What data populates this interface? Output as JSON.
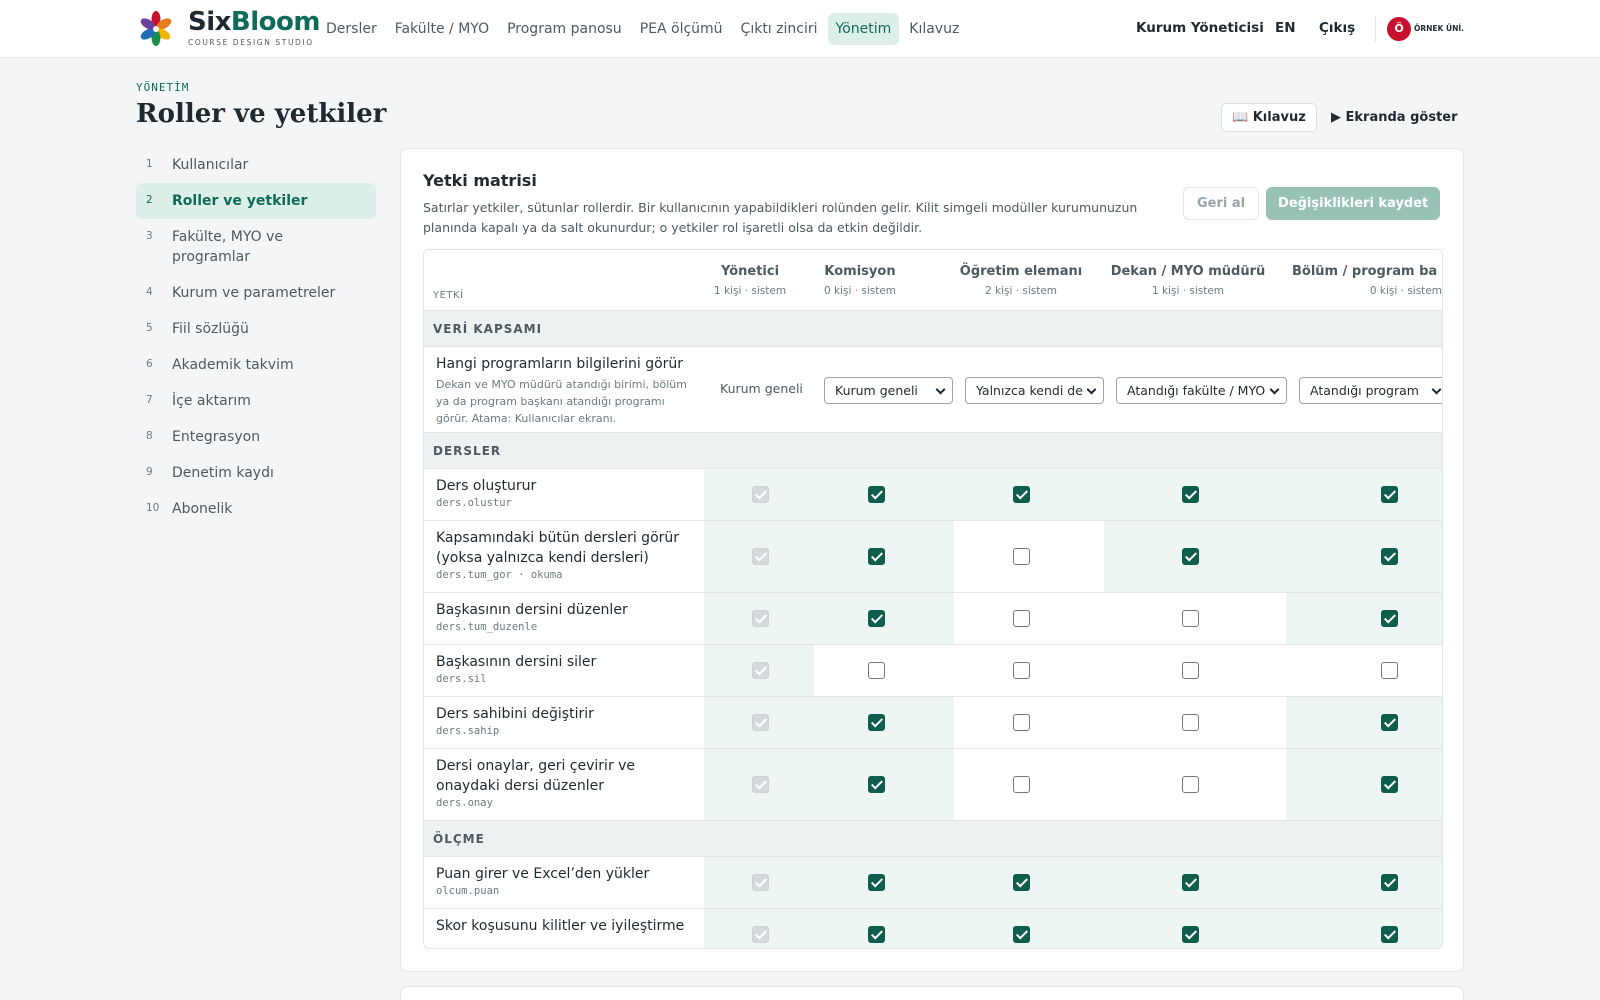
{
  "brand": {
    "name_a": "Six",
    "name_b": "Bloom",
    "subtitle": "COURSE DESIGN STUDIO"
  },
  "nav": [
    {
      "label": "Dersler",
      "active": false
    },
    {
      "label": "Fakülte / MYO",
      "active": false
    },
    {
      "label": "Program panosu",
      "active": false
    },
    {
      "label": "PEA ölçümü",
      "active": false
    },
    {
      "label": "Çıktı zinciri",
      "active": false
    },
    {
      "label": "Yönetim",
      "active": true
    },
    {
      "label": "Kılavuz",
      "active": false
    }
  ],
  "user": {
    "name": "Kurum Yöneticisi",
    "lang": "EN",
    "logout": "Çıkış",
    "org_badge": "Ö",
    "org_name": "ÖRNEK ÜNİ."
  },
  "page": {
    "eyebrow": "YÖNETİM",
    "title": "Roller ve yetkiler",
    "guide_btn": "📖 Kılavuz",
    "show_btn": "▶ Ekranda göster"
  },
  "sidebar": [
    {
      "num": "1",
      "label": "Kullanıcılar"
    },
    {
      "num": "2",
      "label": "Roller ve yetkiler",
      "active": true
    },
    {
      "num": "3",
      "label": "Fakülte, MYO ve programlar"
    },
    {
      "num": "4",
      "label": "Kurum ve parametreler"
    },
    {
      "num": "5",
      "label": "Fiil sözlüğü"
    },
    {
      "num": "6",
      "label": "Akademik takvim"
    },
    {
      "num": "7",
      "label": "İçe aktarım"
    },
    {
      "num": "8",
      "label": "Entegrasyon"
    },
    {
      "num": "9",
      "label": "Denetim kaydı"
    },
    {
      "num": "10",
      "label": "Abonelik"
    }
  ],
  "matrix": {
    "title": "Yetki matrisi",
    "desc": "Satırlar yetkiler, sütunlar rollerdir. Bir kullanıcının yapabildikleri rolünden gelir. Kilit simgeli modüller kurumunuzun planında kapalı ya da salt okunurdur; o yetkiler rol işaretli olsa da etkin değildir.",
    "undo": "Geri al",
    "save": "Değişiklikleri kaydet",
    "col_label": "YETKİ",
    "roles": [
      {
        "name": "Yönetici",
        "meta": "1 kişi · sistem"
      },
      {
        "name": "Komisyon",
        "meta": "0 kişi · sistem"
      },
      {
        "name": "Öğretim elemanı",
        "meta": "2 kişi · sistem"
      },
      {
        "name": "Dekan / MYO müdürü",
        "meta": "1 kişi · sistem"
      },
      {
        "name": "Bölüm / program ba",
        "meta": "0 kişi · sistem"
      }
    ],
    "section_scope": "VERİ KAPSAMI",
    "scope": {
      "title": "Hangi programların bilgilerini görür",
      "hint": "Dekan ve MYO müdürü atandığı birimi, bölüm ya da program başkanı atandığı programı görür. Atama: Kullanıcılar ekranı.",
      "static": "Kurum geneli",
      "selects": [
        "Kurum geneli",
        "Yalnızca kendi de",
        "Atandığı fakülte / MYO",
        "Atandığı program"
      ]
    },
    "sections": [
      {
        "name": "DERSLER",
        "rows": [
          {
            "title": "Ders oluşturur",
            "code": "ders.olustur",
            "checks": [
              1,
              1,
              1,
              1
            ]
          },
          {
            "title": "Kapsamındaki bütün dersleri görür (yoksa yalnızca kendi dersleri)",
            "code": "ders.tum_gor · okuma",
            "checks": [
              1,
              0,
              1,
              1
            ]
          },
          {
            "title": "Başkasının dersini düzenler",
            "code": "ders.tum_duzenle",
            "checks": [
              1,
              0,
              0,
              1
            ]
          },
          {
            "title": "Başkasının dersini siler",
            "code": "ders.sil",
            "checks": [
              0,
              0,
              0,
              0
            ]
          },
          {
            "title": "Ders sahibini değiştirir",
            "code": "ders.sahip",
            "checks": [
              1,
              0,
              0,
              1
            ]
          },
          {
            "title": "Dersi onaylar, geri çevirir ve onaydaki dersi düzenler",
            "code": "ders.onay",
            "checks": [
              1,
              0,
              0,
              1
            ]
          }
        ]
      },
      {
        "name": "ÖLÇME",
        "rows": [
          {
            "title": "Puan girer ve Excel’den yükler",
            "code": "olcum.puan",
            "checks": [
              1,
              1,
              1,
              1
            ]
          },
          {
            "title": "Skor koşusunu kilitler ve iyileştirme",
            "code": "",
            "checks": [
              1,
              1,
              1,
              1
            ]
          }
        ]
      }
    ]
  },
  "colors": {
    "accent": "#0f6b57",
    "checked": "#0f5e4c",
    "save_disabled": "#97c2b5"
  }
}
